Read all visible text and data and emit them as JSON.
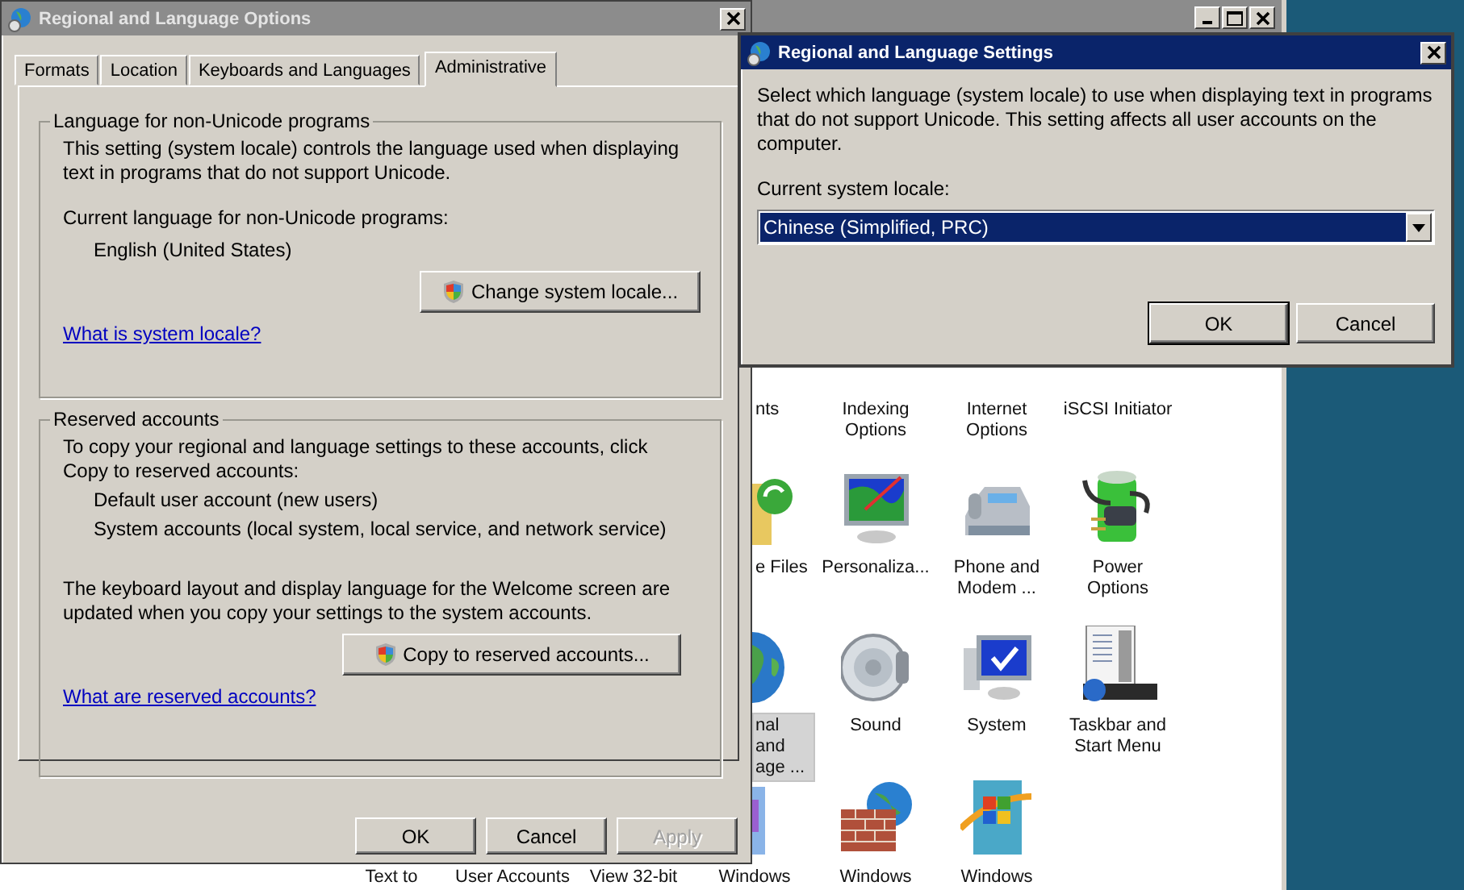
{
  "control_panel": {
    "rows": [
      [
        null,
        null,
        null,
        {
          "label": "nts",
          "selected": false
        },
        {
          "label": "Indexing Options",
          "selected": false
        },
        {
          "label": "Internet Options",
          "selected": false
        },
        {
          "label": "iSCSI Initiator",
          "selected": false
        }
      ],
      [
        null,
        null,
        null,
        {
          "label": "e Files",
          "selected": false
        },
        {
          "label": "Personaliza...",
          "selected": false
        },
        {
          "label": "Phone and Modem ...",
          "selected": false
        },
        {
          "label": "Power Options",
          "selected": false
        }
      ],
      [
        null,
        null,
        null,
        {
          "label": "nal and age ...",
          "selected": true
        },
        {
          "label": "Sound",
          "selected": false
        },
        {
          "label": "System",
          "selected": false
        },
        {
          "label": "Taskbar and Start Menu",
          "selected": false
        }
      ],
      [
        {
          "label": "Text to",
          "selected": false
        },
        {
          "label": "User Accounts",
          "selected": false
        },
        {
          "label": "View 32-bit",
          "selected": false
        },
        {
          "label": "Windows",
          "selected": false
        },
        {
          "label": "Windows",
          "selected": false
        },
        {
          "label": "Windows",
          "selected": false
        }
      ]
    ]
  },
  "options_dialog": {
    "title": "Regional and Language Options",
    "tabs": [
      {
        "label": "Formats",
        "selected": false
      },
      {
        "label": "Location",
        "selected": false
      },
      {
        "label": "Keyboards and Languages",
        "selected": false
      },
      {
        "label": "Administrative",
        "selected": true
      }
    ],
    "locale_group": {
      "title": "Language for non-Unicode programs",
      "description": "This setting (system locale) controls the language used when displaying text in programs that do not support Unicode.",
      "current_label": "Current language for non-Unicode programs:",
      "current_value": "English (United States)",
      "button": "Change system locale...",
      "link": "What is system locale?"
    },
    "reserved_group": {
      "title": "Reserved accounts",
      "description": "To copy your regional and language settings to these accounts, click Copy to reserved accounts:",
      "accounts": [
        "Default user account (new users)",
        "System accounts (local system, local service, and network service)"
      ],
      "note": "The keyboard layout and display language for the Welcome screen are updated when you copy your settings to the system accounts.",
      "button": "Copy to reserved accounts...",
      "link": "What are reserved accounts?"
    },
    "buttons": [
      {
        "label": "OK",
        "disabled": false
      },
      {
        "label": "Cancel",
        "disabled": false
      },
      {
        "label": "Apply",
        "disabled": true
      }
    ]
  },
  "locale_dialog": {
    "title": "Regional and Language Settings",
    "description": "Select which language (system locale) to use when displaying text in programs that do not support Unicode. This setting affects all user accounts on the computer.",
    "locale_label": "Current system locale:",
    "locale_value": "Chinese (Simplified, PRC)",
    "buttons": [
      "OK",
      "Cancel"
    ]
  }
}
